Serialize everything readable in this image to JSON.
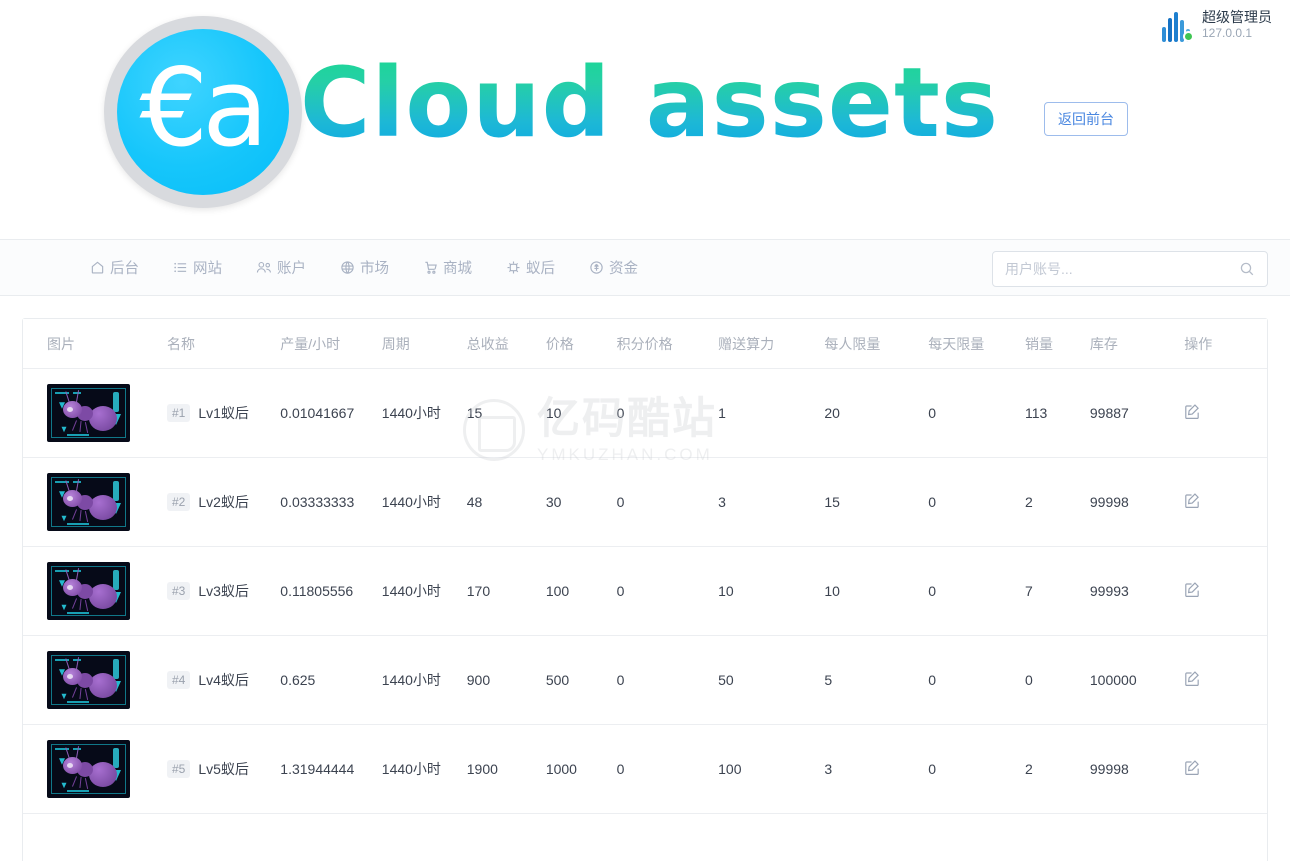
{
  "header": {
    "logo_glyph": "€a",
    "brand_title": "Cloud assets",
    "back_button": "返回前台",
    "user": {
      "name": "超级管理员",
      "ip": "127.0.0.1"
    }
  },
  "nav": {
    "items": [
      {
        "label": "后台",
        "icon": "home-icon"
      },
      {
        "label": "网站",
        "icon": "list-icon"
      },
      {
        "label": "账户",
        "icon": "users-icon"
      },
      {
        "label": "市场",
        "icon": "globe-icon"
      },
      {
        "label": "商城",
        "icon": "cart-icon"
      },
      {
        "label": "蚁后",
        "icon": "gear-bug-icon"
      },
      {
        "label": "资金",
        "icon": "coin-icon"
      }
    ],
    "search": {
      "placeholder": "用户账号...",
      "value": "",
      "icon": "search-icon"
    }
  },
  "table": {
    "columns": [
      "图片",
      "名称",
      "产量/小时",
      "周期",
      "总收益",
      "价格",
      "积分价格",
      "赠送算力",
      "每人限量",
      "每天限量",
      "销量",
      "库存",
      "操作"
    ],
    "rows": [
      {
        "image": "ant-thumbnail",
        "badge": "#1",
        "name": "Lv1蚁后",
        "rate": "0.01041667",
        "cycle": "1440小时",
        "income": "15",
        "price": "10",
        "point_price": "0",
        "power": "1",
        "per_person_limit": "20",
        "per_day_limit": "0",
        "sales": "113",
        "stock": "99887",
        "action": "edit-icon"
      },
      {
        "image": "ant-thumbnail",
        "badge": "#2",
        "name": "Lv2蚁后",
        "rate": "0.03333333",
        "cycle": "1440小时",
        "income": "48",
        "price": "30",
        "point_price": "0",
        "power": "3",
        "per_person_limit": "15",
        "per_day_limit": "0",
        "sales": "2",
        "stock": "99998",
        "action": "edit-icon"
      },
      {
        "image": "ant-thumbnail",
        "badge": "#3",
        "name": "Lv3蚁后",
        "rate": "0.11805556",
        "cycle": "1440小时",
        "income": "170",
        "price": "100",
        "point_price": "0",
        "power": "10",
        "per_person_limit": "10",
        "per_day_limit": "0",
        "sales": "7",
        "stock": "99993",
        "action": "edit-icon"
      },
      {
        "image": "ant-thumbnail",
        "badge": "#4",
        "name": "Lv4蚁后",
        "rate": "0.625",
        "cycle": "1440小时",
        "income": "900",
        "price": "500",
        "point_price": "0",
        "power": "50",
        "per_person_limit": "5",
        "per_day_limit": "0",
        "sales": "0",
        "stock": "100000",
        "action": "edit-icon"
      },
      {
        "image": "ant-thumbnail",
        "badge": "#5",
        "name": "Lv5蚁后",
        "rate": "1.31944444",
        "cycle": "1440小时",
        "income": "1900",
        "price": "1000",
        "point_price": "0",
        "power": "100",
        "per_person_limit": "3",
        "per_day_limit": "0",
        "sales": "2",
        "stock": "99998",
        "action": "edit-icon"
      }
    ]
  },
  "watermark": {
    "cn": "亿码酷站",
    "en": "YMKUZHAN.COM"
  },
  "colors": {
    "brand_start": "#19d98f",
    "brand_end": "#0aa6e8",
    "logo_coin": "#16c6fb",
    "link_blue": "#4a87e0",
    "status_green": "#3fc553"
  }
}
